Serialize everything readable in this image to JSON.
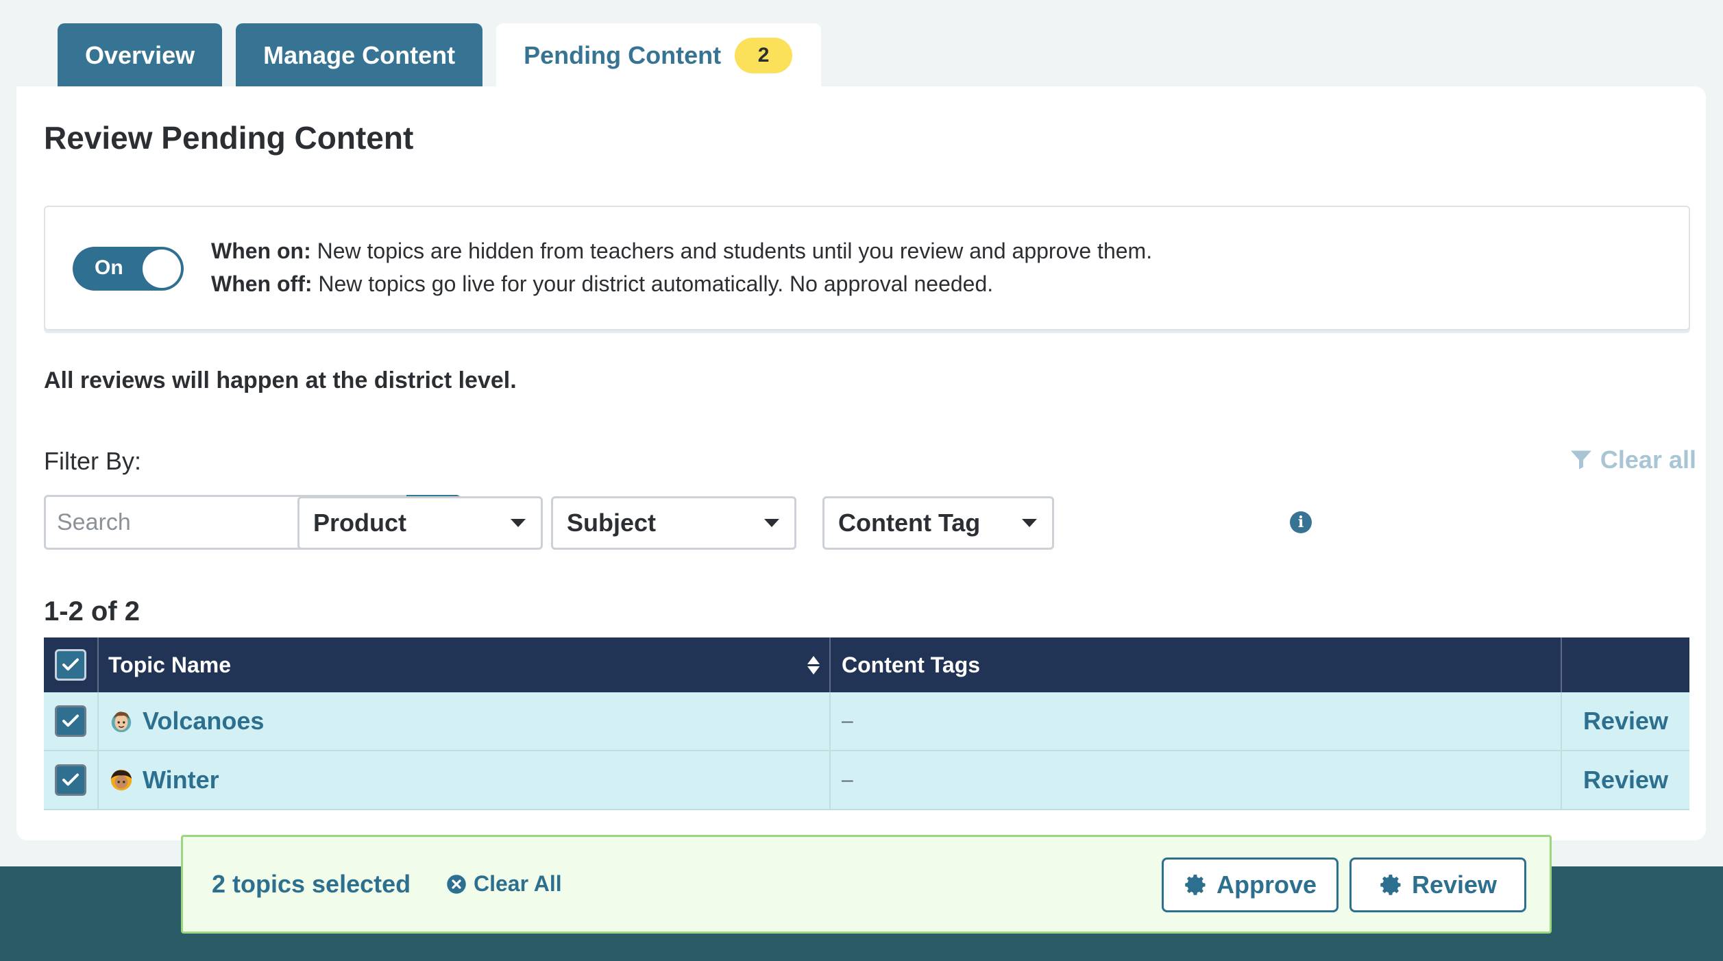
{
  "tabs": [
    {
      "label": "Overview"
    },
    {
      "label": "Manage Content"
    },
    {
      "label": "Pending Content",
      "badge": "2"
    }
  ],
  "page": {
    "title": "Review Pending Content"
  },
  "approval_toggle": {
    "state_label": "On",
    "when_on_label": "When on:",
    "when_on_text": " New topics are hidden from teachers and students until you review and approve them.",
    "when_off_label": "When off:",
    "when_off_text": " New topics go live for your district automatically. No approval needed."
  },
  "district_note": "All reviews will happen at the district level.",
  "filters": {
    "label": "Filter By:",
    "clear_all": "Clear all",
    "search_placeholder": "Search",
    "product": "Product",
    "subject": "Subject",
    "content_tag": "Content Tag"
  },
  "results": {
    "count_text": "1-2 of 2"
  },
  "table": {
    "columns": {
      "topic_name": "Topic Name",
      "content_tags": "Content Tags"
    },
    "rows": [
      {
        "name": "Volcanoes",
        "tags": "–",
        "action": "Review",
        "checked": true,
        "avatar": "boy-character-icon"
      },
      {
        "name": "Winter",
        "tags": "–",
        "action": "Review",
        "checked": true,
        "avatar": "girl-character-icon"
      }
    ]
  },
  "selection_bar": {
    "count_text": "2 topics selected",
    "clear_all": "Clear All",
    "approve": "Approve",
    "review": "Review"
  },
  "colors": {
    "tab_bg": "#377494",
    "header_bg": "#223456",
    "row_bg": "#d3f1f4",
    "badge": "#fbe05a",
    "link": "#2d6f8e",
    "action_bar_bg": "#f1fdea"
  }
}
